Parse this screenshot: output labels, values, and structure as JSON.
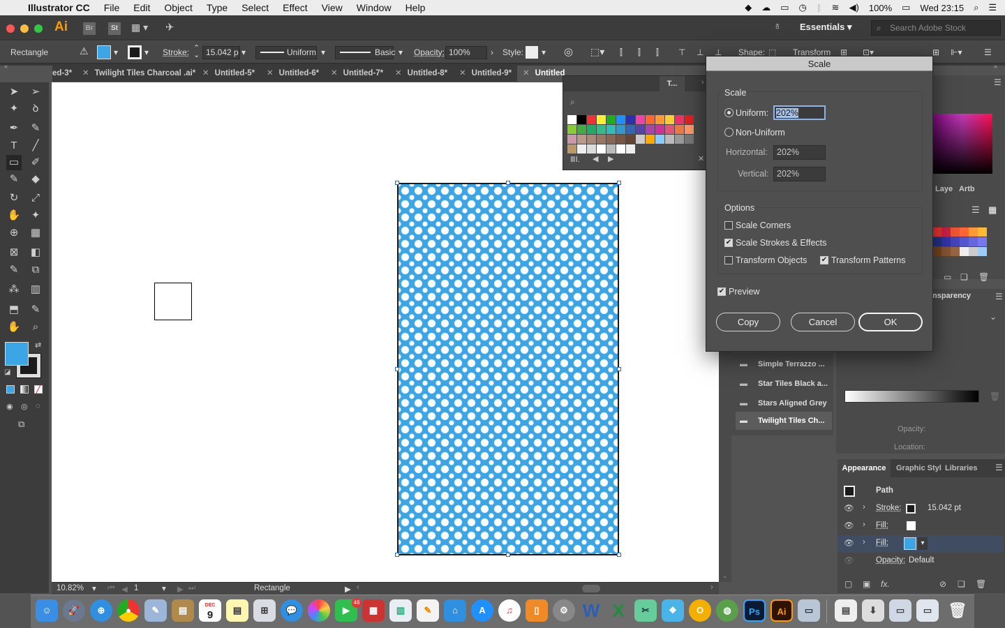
{
  "menubar": {
    "apple": "",
    "items": [
      "Illustrator CC",
      "File",
      "Edit",
      "Object",
      "Type",
      "Select",
      "Effect",
      "View",
      "Window",
      "Help"
    ],
    "battery": "100%",
    "clock": "Wed 23:15"
  },
  "appbar": {
    "logo": "Ai",
    "br": "Br",
    "st": "St",
    "workspace": "Essentials",
    "search_placeholder": "Search Adobe Stock"
  },
  "control": {
    "object_type": "Rectangle",
    "stroke_label": "Stroke:",
    "stroke_value": "15.042 p",
    "profile": "Uniform",
    "brush": "Basic",
    "opacity_label": "Opacity:",
    "opacity_value": "100%",
    "style_label": "Style:",
    "shape_label": "Shape:",
    "transform_label": "Transform"
  },
  "tabs": [
    {
      "label": "ed-3*"
    },
    {
      "label": "Twilight Tiles Charcoal .ai*"
    },
    {
      "label": "Untitled-5*"
    },
    {
      "label": "Untitled-6*"
    },
    {
      "label": "Untitled-7*"
    },
    {
      "label": "Untitled-8*"
    },
    {
      "label": "Untitled-9*"
    },
    {
      "label": "Untitled"
    }
  ],
  "swatch_panel": {
    "tab": "T..."
  },
  "status": {
    "zoom": "10.82%",
    "artboard": "1",
    "tool": "Rectangle"
  },
  "dialog": {
    "title": "Scale",
    "scale_group": "Scale",
    "uniform_label": "Uniform:",
    "uniform_value": "202%",
    "nonuniform_label": "Non-Uniform",
    "horizontal_label": "Horizontal:",
    "horizontal_value": "202%",
    "vertical_label": "Vertical:",
    "vertical_value": "202%",
    "options_group": "Options",
    "scale_corners": "Scale Corners",
    "scale_strokes": "Scale Strokes & Effects",
    "transform_objects": "Transform Objects",
    "transform_patterns": "Transform Patterns",
    "preview": "Preview",
    "copy": "Copy",
    "cancel": "Cancel",
    "ok": "OK",
    "checks": {
      "scale_corners": false,
      "scale_strokes": true,
      "transform_objects": false,
      "transform_patterns": true,
      "preview": true
    }
  },
  "right": {
    "layers_tab": "Laye",
    "artboards_tab": "Artb",
    "transparency_tab": "nsparency",
    "opacity_label": "Opacity:",
    "location_label": "Location:",
    "libraries": [
      "Simple Terrazzo ...",
      "Star Tiles Black a...",
      "Stars Aligned Grey",
      "Twilight Tiles Ch..."
    ]
  },
  "appearance": {
    "tabs": [
      "Appearance",
      "Graphic Styl",
      "Libraries"
    ],
    "path": "Path",
    "stroke_label": "Stroke:",
    "stroke_value": "15.042 pt",
    "fill_label": "Fill:",
    "opacity_label": "Opacity:",
    "opacity_value": "Default"
  },
  "colors": {
    "accent_blue": "#3ba5e6",
    "ai_orange": "#ff9a00",
    "dialog_bg": "#4f4f4f"
  },
  "dock": {
    "calendar_month": "DEC",
    "calendar_day": "9",
    "mail_badge": "46",
    "word": "W",
    "excel": "X",
    "ps": "Ps",
    "ai": "Ai"
  }
}
